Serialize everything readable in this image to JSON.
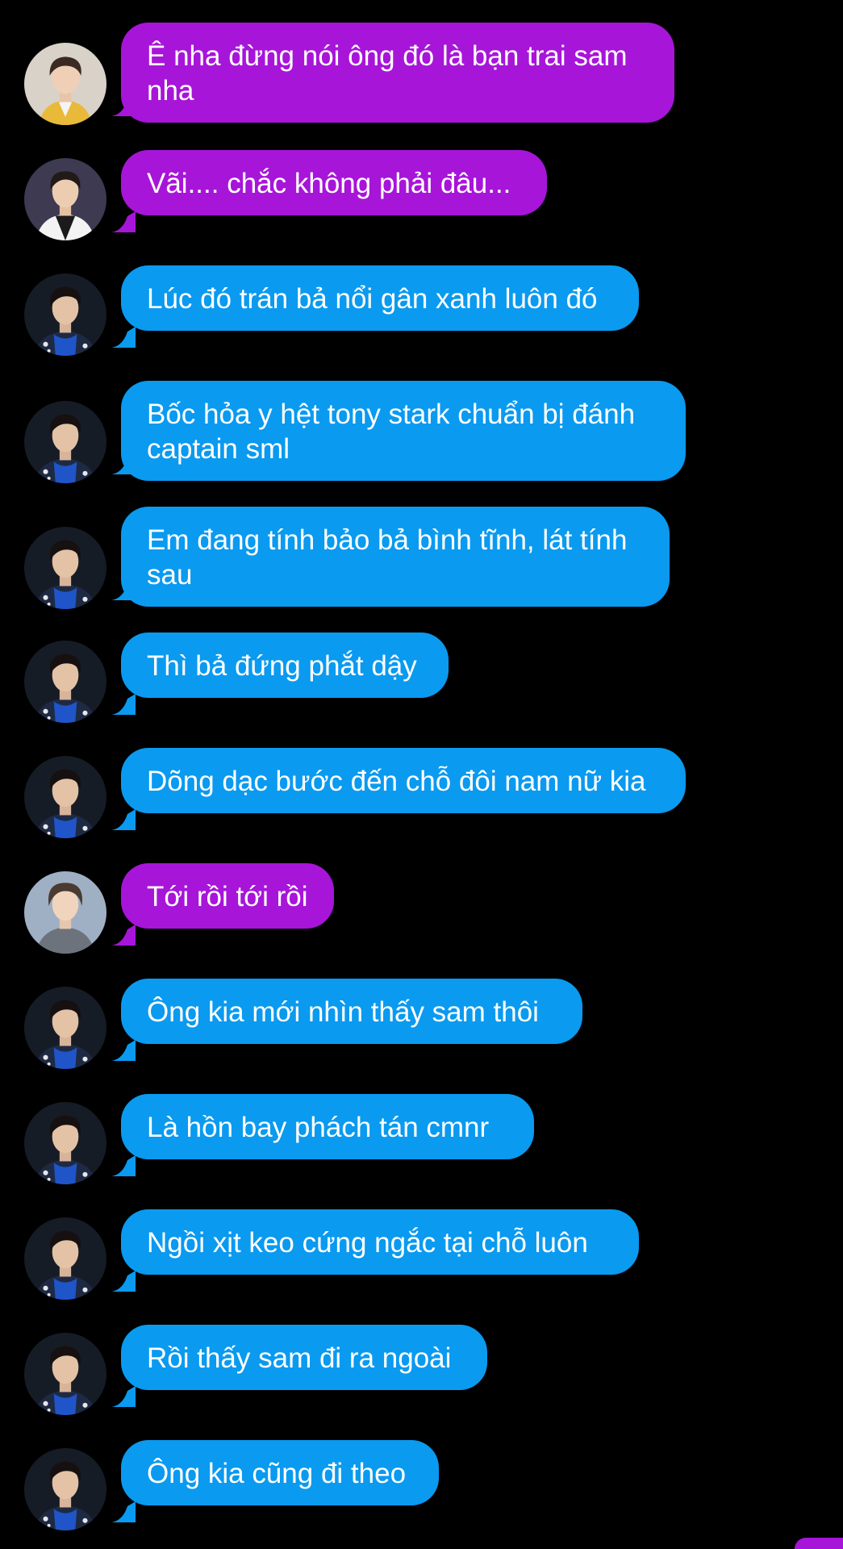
{
  "colors": {
    "background": "#000000",
    "purple_bubble": "#a715d9",
    "blue_bubble": "#0a9af0",
    "text": "#ffffff"
  },
  "messages": [
    {
      "avatar": "avatar-yellow-jacket",
      "color": "purple",
      "text": "Ê nha đừng nói ông đó là bạn trai sam nha"
    },
    {
      "avatar": "avatar-white-shirt",
      "color": "purple",
      "text": "Vãi.... chắc không phải đâu..."
    },
    {
      "avatar": "avatar-blue-outfit",
      "color": "blue",
      "text": "Lúc đó trán bả nổi gân xanh luôn đó"
    },
    {
      "avatar": "avatar-blue-outfit",
      "color": "blue",
      "text": "Bốc hỏa y hệt tony stark chuẩn bị đánh captain sml"
    },
    {
      "avatar": "avatar-blue-outfit",
      "color": "blue",
      "text": "Em đang tính bảo bả bình tĩnh, lát tính sau"
    },
    {
      "avatar": "avatar-blue-outfit",
      "color": "blue",
      "text": "Thì bả đứng phắt dậy"
    },
    {
      "avatar": "avatar-blue-outfit",
      "color": "blue",
      "text": "Dõng dạc bước đến chỗ đôi nam nữ kia"
    },
    {
      "avatar": "avatar-grey-jacket",
      "color": "purple",
      "text": "Tới rồi tới rồi"
    },
    {
      "avatar": "avatar-blue-outfit",
      "color": "blue",
      "text": "Ông kia mới nhìn thấy sam thôi"
    },
    {
      "avatar": "avatar-blue-outfit",
      "color": "blue",
      "text": "Là hồn bay phách tán cmnr"
    },
    {
      "avatar": "avatar-blue-outfit",
      "color": "blue",
      "text": "Ngồi xịt keo cứng ngắc tại chỗ luôn"
    },
    {
      "avatar": "avatar-blue-outfit",
      "color": "blue",
      "text": "Rồi thấy sam đi ra ngoài"
    },
    {
      "avatar": "avatar-blue-outfit",
      "color": "blue",
      "text": "Ông kia cũng đi theo"
    }
  ]
}
